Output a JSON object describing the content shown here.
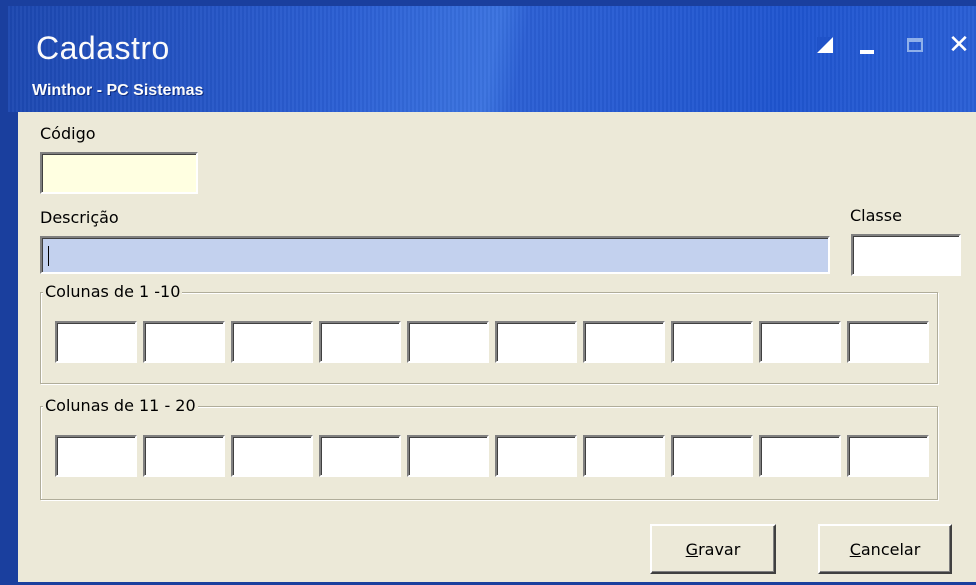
{
  "window": {
    "title": "Cadastro",
    "subtitle": "Winthor - PC Sistemas",
    "controls": [
      "edit-icon",
      "minimize-icon",
      "maximize-icon",
      "close-icon"
    ],
    "close_glyph": "✕"
  },
  "form": {
    "codigo_label": "Código",
    "codigo_value": "",
    "descricao_label": "Descrição",
    "descricao_value": "",
    "classe_label": "Classe",
    "classe_value": "",
    "group1_label": "Colunas de 1 -10",
    "group2_label": "Colunas de 11 - 20",
    "group1_count": 10,
    "group2_count": 10
  },
  "buttons": {
    "save_accel": "G",
    "save_rest": "ravar",
    "cancel_accel": "C",
    "cancel_rest": "ancelar"
  },
  "colors": {
    "titlebar": "#2b5fd4",
    "client_bg": "#ece9d8",
    "codigo_bg": "#ffffe1",
    "descricao_bg": "#c3d1ee"
  }
}
